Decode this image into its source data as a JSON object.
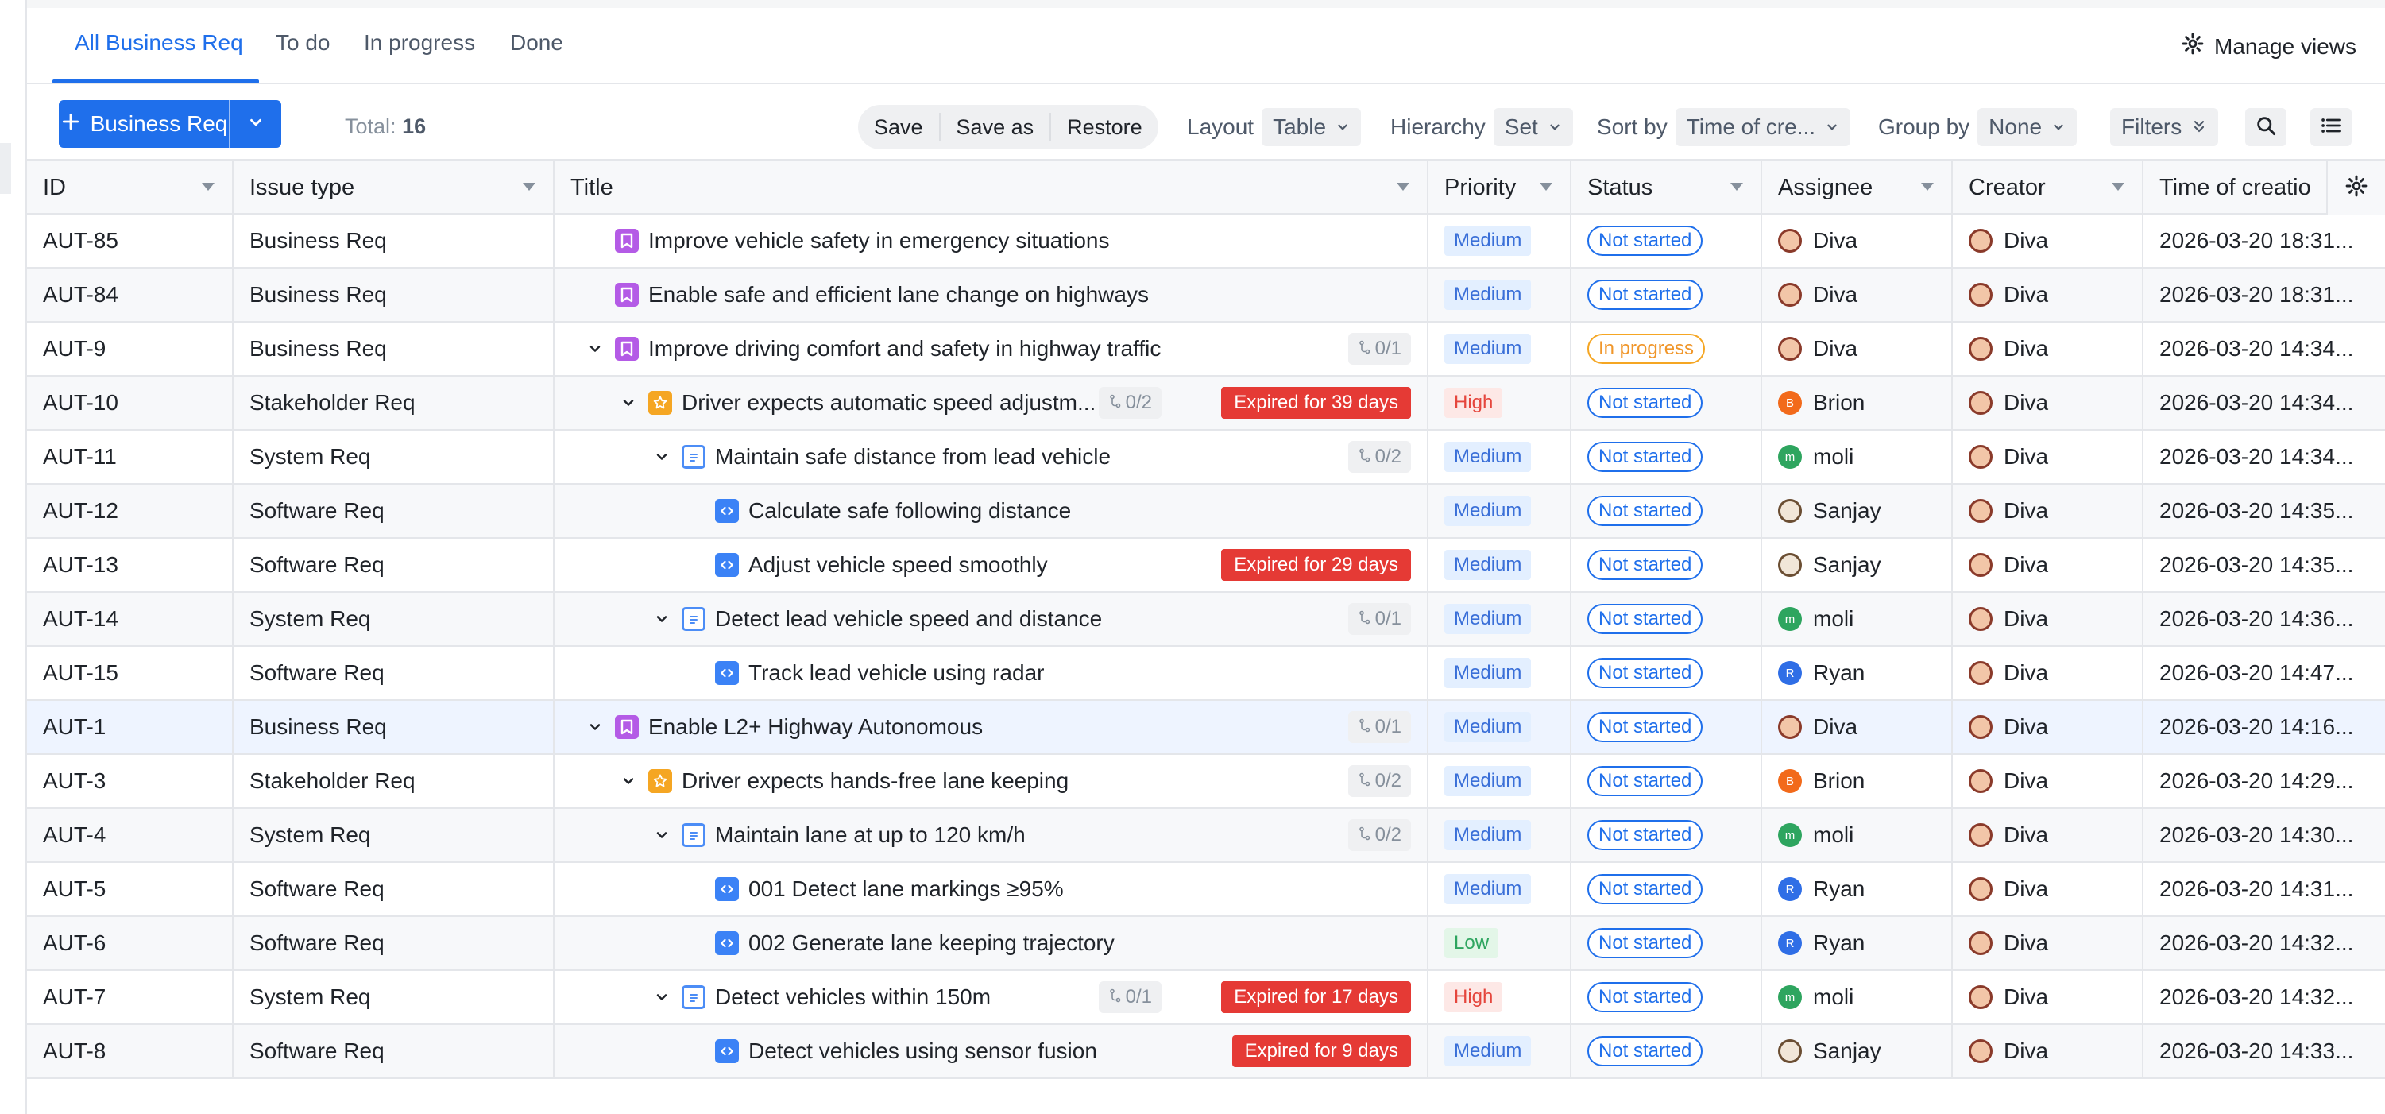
{
  "tabs": [
    {
      "label": "All Business Req",
      "active": true
    },
    {
      "label": "To do"
    },
    {
      "label": "In progress"
    },
    {
      "label": "Done"
    }
  ],
  "manage_views": {
    "label": "Manage views",
    "icon": "gear-icon"
  },
  "toolbar": {
    "create_label": "Business Req",
    "total_label": "Total:",
    "total_value": "16",
    "save_label": "Save",
    "save_as_label": "Save as",
    "restore_label": "Restore",
    "layout_label": "Layout",
    "layout_value": "Table",
    "hierarchy_label": "Hierarchy",
    "hierarchy_value": "Set",
    "sort_label": "Sort by",
    "sort_value": "Time of cre...",
    "group_label": "Group by",
    "group_value": "None",
    "filters_label": "Filters"
  },
  "columns": [
    {
      "key": "id",
      "label": "ID"
    },
    {
      "key": "type",
      "label": "Issue type"
    },
    {
      "key": "title",
      "label": "Title"
    },
    {
      "key": "priority",
      "label": "Priority"
    },
    {
      "key": "status",
      "label": "Status"
    },
    {
      "key": "assignee",
      "label": "Assignee"
    },
    {
      "key": "creator",
      "label": "Creator"
    },
    {
      "key": "created",
      "label": "Time of creatio"
    }
  ],
  "colors": {
    "accent": "#1f6feb",
    "expired": "#e53a35",
    "in_progress": "#f5a623"
  },
  "rows": [
    {
      "id": "AUT-85",
      "type": "Business Req",
      "level": 0,
      "chevron": false,
      "icon": "bookmark-icon",
      "title": "Improve vehicle safety in emergency situations",
      "subcount": "",
      "expired": "",
      "priority": "Medium",
      "status": "Not started",
      "assignee": "Diva",
      "assignee_avatar": "diva",
      "creator": "Diva",
      "created": "2026-03-20 18:31..."
    },
    {
      "id": "AUT-84",
      "type": "Business Req",
      "level": 0,
      "chevron": false,
      "icon": "bookmark-icon",
      "title": "Enable safe and efficient lane change on highways",
      "subcount": "",
      "expired": "",
      "priority": "Medium",
      "status": "Not started",
      "assignee": "Diva",
      "assignee_avatar": "diva",
      "creator": "Diva",
      "created": "2026-03-20 18:31..."
    },
    {
      "id": "AUT-9",
      "type": "Business Req",
      "level": 0,
      "chevron": true,
      "icon": "bookmark-icon",
      "title": "Improve driving comfort and safety in highway traffic",
      "subcount": "0/1",
      "expired": "",
      "priority": "Medium",
      "status": "In progress",
      "assignee": "Diva",
      "assignee_avatar": "diva",
      "creator": "Diva",
      "created": "2026-03-20 14:34..."
    },
    {
      "id": "AUT-10",
      "type": "Stakeholder Req",
      "level": 1,
      "chevron": true,
      "icon": "star-icon",
      "title": "Driver expects automatic speed adjustm...",
      "subcount": "0/2",
      "expired": "Expired for 39 days",
      "priority": "High",
      "status": "Not started",
      "assignee": "Brion",
      "assignee_avatar": "brion",
      "creator": "Diva",
      "created": "2026-03-20 14:34..."
    },
    {
      "id": "AUT-11",
      "type": "System Req",
      "level": 2,
      "chevron": true,
      "icon": "clipboard-icon",
      "title": "Maintain safe distance from lead vehicle",
      "subcount": "0/2",
      "expired": "",
      "priority": "Medium",
      "status": "Not started",
      "assignee": "moli",
      "assignee_avatar": "moli",
      "creator": "Diva",
      "created": "2026-03-20 14:34..."
    },
    {
      "id": "AUT-12",
      "type": "Software Req",
      "level": 3,
      "chevron": false,
      "icon": "code-icon",
      "title": "Calculate safe following distance",
      "subcount": "",
      "expired": "",
      "priority": "Medium",
      "status": "Not started",
      "assignee": "Sanjay",
      "assignee_avatar": "sanjay",
      "creator": "Diva",
      "created": "2026-03-20 14:35..."
    },
    {
      "id": "AUT-13",
      "type": "Software Req",
      "level": 3,
      "chevron": false,
      "icon": "code-icon",
      "title": "Adjust vehicle speed smoothly",
      "subcount": "",
      "expired": "Expired for 29 days",
      "priority": "Medium",
      "status": "Not started",
      "assignee": "Sanjay",
      "assignee_avatar": "sanjay",
      "creator": "Diva",
      "created": "2026-03-20 14:35..."
    },
    {
      "id": "AUT-14",
      "type": "System Req",
      "level": 2,
      "chevron": true,
      "icon": "clipboard-icon",
      "title": "Detect lead vehicle speed and distance",
      "subcount": "0/1",
      "expired": "",
      "priority": "Medium",
      "status": "Not started",
      "assignee": "moli",
      "assignee_avatar": "moli",
      "creator": "Diva",
      "created": "2026-03-20 14:36..."
    },
    {
      "id": "AUT-15",
      "type": "Software Req",
      "level": 3,
      "chevron": false,
      "icon": "code-icon",
      "title": "Track lead vehicle using radar",
      "subcount": "",
      "expired": "",
      "priority": "Medium",
      "status": "Not started",
      "assignee": "Ryan",
      "assignee_avatar": "ryan",
      "creator": "Diva",
      "created": "2026-03-20 14:47..."
    },
    {
      "id": "AUT-1",
      "type": "Business Req",
      "level": 0,
      "chevron": true,
      "icon": "bookmark-icon",
      "title": "Enable L2+ Highway Autonomous",
      "subcount": "0/1",
      "expired": "",
      "priority": "Medium",
      "status": "Not started",
      "assignee": "Diva",
      "assignee_avatar": "diva",
      "creator": "Diva",
      "created": "2026-03-20 14:16...",
      "highlight": true
    },
    {
      "id": "AUT-3",
      "type": "Stakeholder Req",
      "level": 1,
      "chevron": true,
      "icon": "star-icon",
      "title": "Driver expects hands-free lane keeping",
      "subcount": "0/2",
      "expired": "",
      "priority": "Medium",
      "status": "Not started",
      "assignee": "Brion",
      "assignee_avatar": "brion",
      "creator": "Diva",
      "created": "2026-03-20 14:29..."
    },
    {
      "id": "AUT-4",
      "type": "System Req",
      "level": 2,
      "chevron": true,
      "icon": "clipboard-icon",
      "title": "Maintain lane at up to 120 km/h",
      "subcount": "0/2",
      "expired": "",
      "priority": "Medium",
      "status": "Not started",
      "assignee": "moli",
      "assignee_avatar": "moli",
      "creator": "Diva",
      "created": "2026-03-20 14:30..."
    },
    {
      "id": "AUT-5",
      "type": "Software Req",
      "level": 3,
      "chevron": false,
      "icon": "code-icon",
      "title": "001 Detect lane markings ≥95%",
      "subcount": "",
      "expired": "",
      "priority": "Medium",
      "status": "Not started",
      "assignee": "Ryan",
      "assignee_avatar": "ryan",
      "creator": "Diva",
      "created": "2026-03-20 14:31..."
    },
    {
      "id": "AUT-6",
      "type": "Software Req",
      "level": 3,
      "chevron": false,
      "icon": "code-icon",
      "title": "002 Generate lane keeping trajectory",
      "subcount": "",
      "expired": "",
      "priority": "Low",
      "status": "Not started",
      "assignee": "Ryan",
      "assignee_avatar": "ryan",
      "creator": "Diva",
      "created": "2026-03-20 14:32..."
    },
    {
      "id": "AUT-7",
      "type": "System Req",
      "level": 2,
      "chevron": true,
      "icon": "clipboard-icon",
      "title": "Detect vehicles within 150m",
      "subcount": "0/1",
      "expired": "Expired for 17 days",
      "priority": "High",
      "status": "Not started",
      "assignee": "moli",
      "assignee_avatar": "moli",
      "creator": "Diva",
      "created": "2026-03-20 14:32..."
    },
    {
      "id": "AUT-8",
      "type": "Software Req",
      "level": 3,
      "chevron": false,
      "icon": "code-icon",
      "title": "Detect vehicles using sensor fusion",
      "subcount": "",
      "expired": "Expired for 9 days",
      "priority": "Medium",
      "status": "Not started",
      "assignee": "Sanjay",
      "assignee_avatar": "sanjay",
      "creator": "Diva",
      "created": "2026-03-20 14:33..."
    }
  ]
}
